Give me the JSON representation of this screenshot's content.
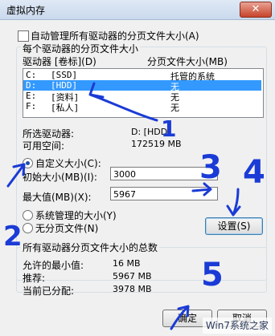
{
  "window": {
    "title": "虚拟内存",
    "close_glyph": "✕"
  },
  "auto_manage": {
    "label": "自动管理所有驱动器的分页文件大小(A)",
    "checked": false
  },
  "per_drive": {
    "group_title": "每个驱动器的分页文件大小",
    "col_drive": "驱动器 [卷标](D)",
    "col_size": "分页文件大小(MB)",
    "rows": [
      {
        "drive": "C:",
        "label": "[SSD]",
        "size": "托管的系统",
        "selected": false
      },
      {
        "drive": "D:",
        "label": "[HDD]",
        "size": "无",
        "selected": true
      },
      {
        "drive": "E:",
        "label": "[资料]",
        "size": "无",
        "selected": false
      },
      {
        "drive": "F:",
        "label": "[私人]",
        "size": "无",
        "selected": false
      }
    ],
    "selected_drive_label": "所选驱动器:",
    "selected_drive_value": "D:  [HDD]",
    "free_space_label": "可用空间:",
    "free_space_value": "172519 MB",
    "custom_size_label": "自定义大小(C):",
    "initial_size_label": "初始大小(MB)(I):",
    "initial_size_value": "3000",
    "max_size_label": "最大值(MB)(X):",
    "max_size_value": "5967",
    "system_managed_label": "系统管理的大小(Y)",
    "no_paging_label": "无分页文件(N)",
    "selected_option": "custom",
    "set_button": "设置(S)"
  },
  "totals": {
    "group_title": "所有驱动器分页文件大小的总数",
    "min_label": "允许的最小值:",
    "min_value": "16 MB",
    "recommended_label": "推荐:",
    "recommended_value": "5967 MB",
    "allocated_label": "当前已分配:",
    "allocated_value": "3978 MB"
  },
  "buttons": {
    "ok": "确定",
    "cancel": "取消"
  },
  "annotations": {
    "color": "#1a3bd6",
    "numbers": [
      "1",
      "2",
      "3",
      "4",
      "5"
    ]
  },
  "watermark": "Win7系统之家"
}
